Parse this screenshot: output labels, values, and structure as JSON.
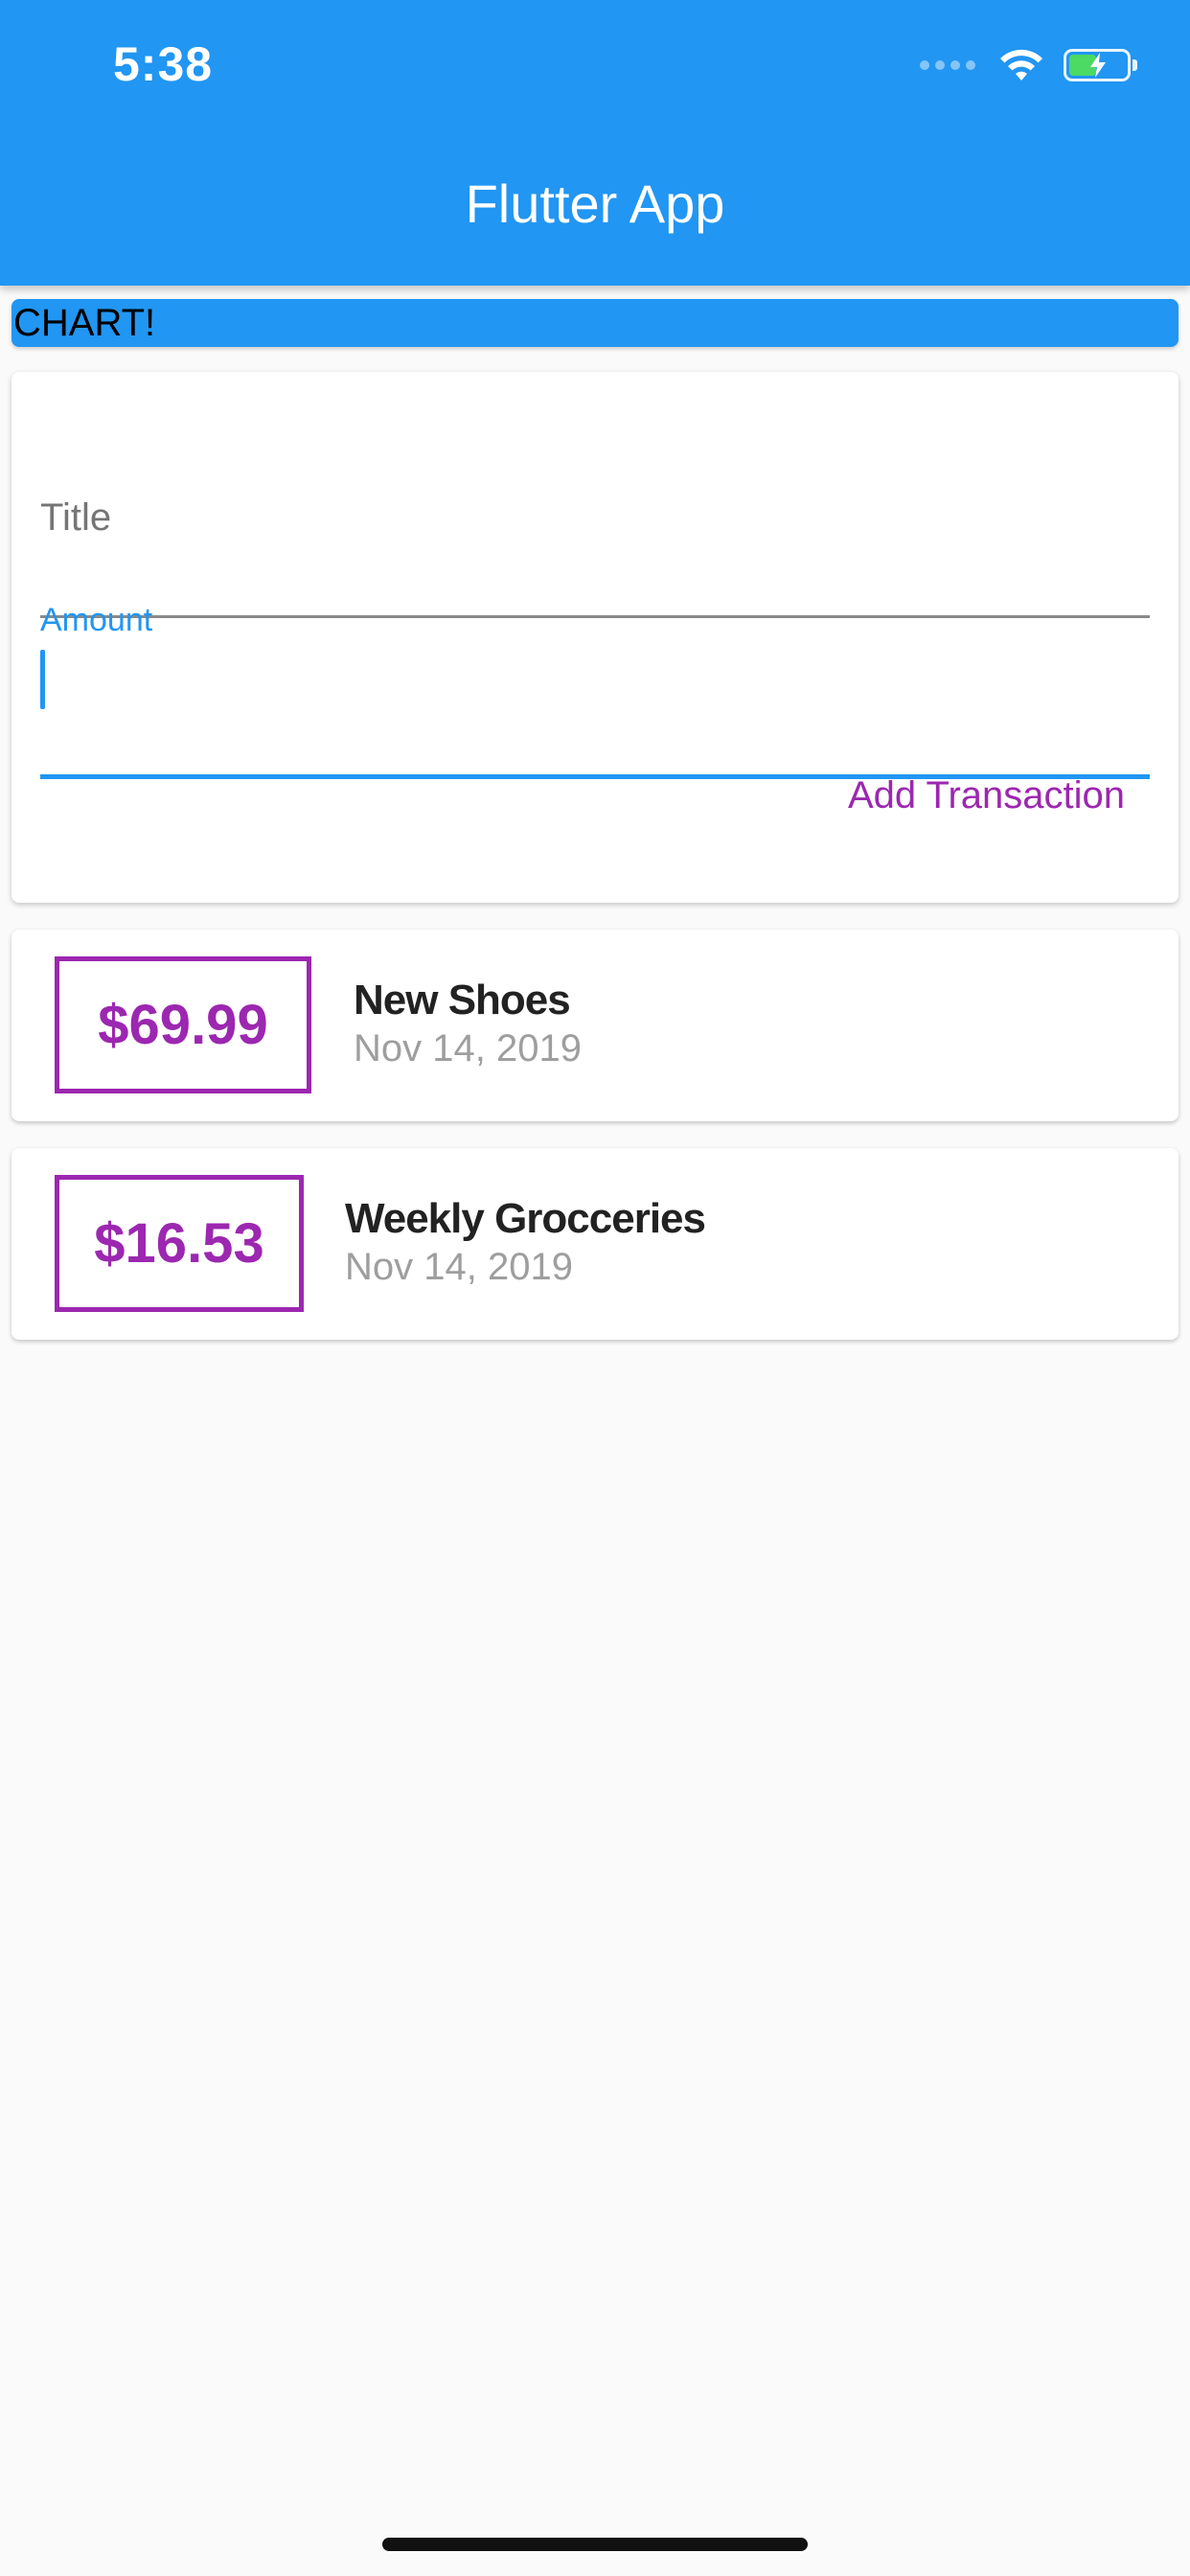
{
  "status_bar": {
    "time": "5:38",
    "icons": [
      "signal-dots-icon",
      "wifi-icon",
      "battery-charging-icon"
    ],
    "battery_color": "#4cd964"
  },
  "app_bar": {
    "title": "Flutter App",
    "color": "#2196f3"
  },
  "chart": {
    "label": "CHART!"
  },
  "form": {
    "title_placeholder": "Title",
    "amount_label": "Amount",
    "amount_value": "",
    "submit_label": "Add Transaction",
    "accent_color": "#9c27b0"
  },
  "transactions": [
    {
      "amount": "$69.99",
      "title": "New Shoes",
      "date": "Nov 14, 2019"
    },
    {
      "amount": "$16.53",
      "title": "Weekly Grocceries",
      "date": "Nov 14, 2019"
    }
  ]
}
